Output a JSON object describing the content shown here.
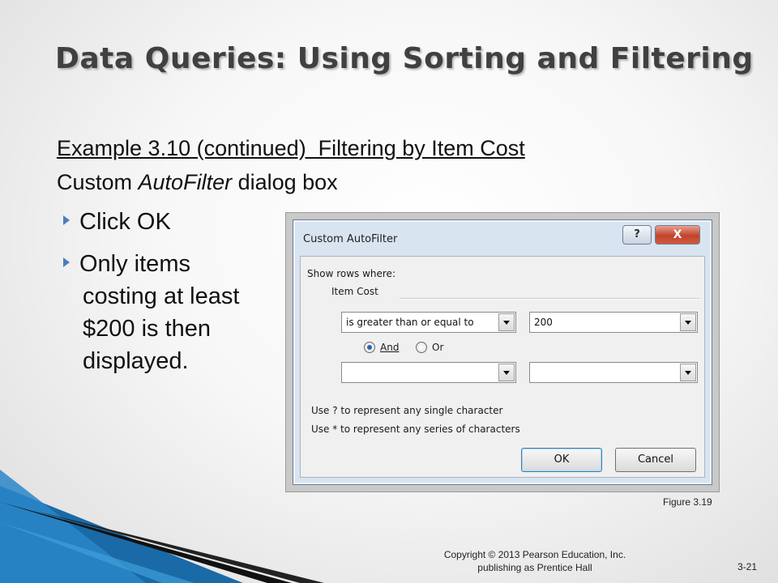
{
  "slide": {
    "title": "Data Queries: Using Sorting and Filtering",
    "subtitle_line1": "Example 3.10 (continued)  Filtering by Item Cost",
    "subtitle_line2_pre": "Custom ",
    "subtitle_line2_italic": "AutoFilter",
    "subtitle_line2_post": " dialog box",
    "bullets": [
      {
        "text": "Click OK"
      },
      {
        "line1": "Only items",
        "line2": "costing at least",
        "line3": "$200 is then",
        "line4": "displayed."
      }
    ],
    "figure_caption": "Figure 3.19",
    "copyright_line1": "Copyright © 2013 Pearson Education, Inc.",
    "copyright_line2": "publishing as Prentice Hall",
    "page_number": "3-21"
  },
  "dialog": {
    "title": "Custom AutoFilter",
    "help_label": "?",
    "close_label": "X",
    "show_rows_label": "Show rows where:",
    "field_label": "Item Cost",
    "row1": {
      "operator": "is greater than or equal to",
      "value": "200"
    },
    "radio_and": "And",
    "radio_or": "Or",
    "radio_selected": "And",
    "row2": {
      "operator": "",
      "value": ""
    },
    "hint1": "Use ? to represent any single character",
    "hint2": "Use * to represent any series of characters",
    "ok_label": "OK",
    "cancel_label": "Cancel"
  },
  "colors": {
    "accent": "#4a7fb5",
    "title_text": "#404040",
    "dialog_bg": "#d9e4f1",
    "close_button": "#c0432c"
  }
}
